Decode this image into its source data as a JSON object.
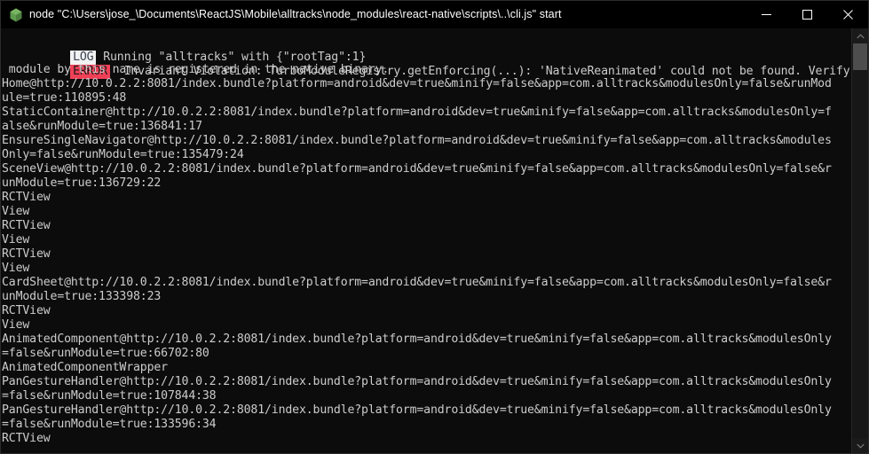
{
  "window": {
    "title": "node  \"C:\\Users\\jose_\\Documents\\ReactJS\\Mobile\\alltracks\\node_modules\\react-native\\scripts\\..\\cli.js\" start",
    "icon": "nodejs-hexagon-icon",
    "background_color": "#0c0c0c",
    "titlebar_color": "#000000",
    "text_color": "#cccccc",
    "controls": {
      "minimize": "minimize-icon",
      "maximize": "maximize-icon",
      "close": "close-icon"
    }
  },
  "console": {
    "badges": {
      "log": {
        "label": "LOG",
        "background": "#f2f2f2",
        "color": "#3b4252"
      },
      "error": {
        "label": "ERROR",
        "background": "#ef4056",
        "color": "#1a1a1a"
      }
    },
    "log_line": {
      "badge": "LOG",
      "text": " Running \"alltracks\" with {\"rootTag\":1}"
    },
    "error_line": {
      "badge": "ERROR",
      "text": "  Invariant Violation: TurboModuleRegistry.getEnforcing(...): 'NativeReanimated' could not be found. Verify that a"
    },
    "lines": [
      " module by this name is registered in the native binary.",
      "Home@http://10.0.2.2:8081/index.bundle?platform=android&dev=true&minify=false&app=com.alltracks&modulesOnly=false&runMod",
      "ule=true:110895:48",
      "StaticContainer@http://10.0.2.2:8081/index.bundle?platform=android&dev=true&minify=false&app=com.alltracks&modulesOnly=f",
      "alse&runModule=true:136841:17",
      "EnsureSingleNavigator@http://10.0.2.2:8081/index.bundle?platform=android&dev=true&minify=false&app=com.alltracks&modules",
      "Only=false&runModule=true:135479:24",
      "SceneView@http://10.0.2.2:8081/index.bundle?platform=android&dev=true&minify=false&app=com.alltracks&modulesOnly=false&r",
      "unModule=true:136729:22",
      "RCTView",
      "View",
      "RCTView",
      "View",
      "RCTView",
      "View",
      "CardSheet@http://10.0.2.2:8081/index.bundle?platform=android&dev=true&minify=false&app=com.alltracks&modulesOnly=false&r",
      "unModule=true:133398:23",
      "RCTView",
      "View",
      "AnimatedComponent@http://10.0.2.2:8081/index.bundle?platform=android&dev=true&minify=false&app=com.alltracks&modulesOnly",
      "=false&runModule=true:66702:80",
      "AnimatedComponentWrapper",
      "PanGestureHandler@http://10.0.2.2:8081/index.bundle?platform=android&dev=true&minify=false&app=com.alltracks&modulesOnly",
      "=false&runModule=true:107844:38",
      "PanGestureHandler@http://10.0.2.2:8081/index.bundle?platform=android&dev=true&minify=false&app=com.alltracks&modulesOnly",
      "=false&runModule=true:133596:34",
      "RCTView"
    ]
  },
  "scrollbar": {
    "up_arrow": "chevron-up-icon",
    "down_arrow": "chevron-down-icon",
    "thumb": "scrollbar-thumb"
  }
}
